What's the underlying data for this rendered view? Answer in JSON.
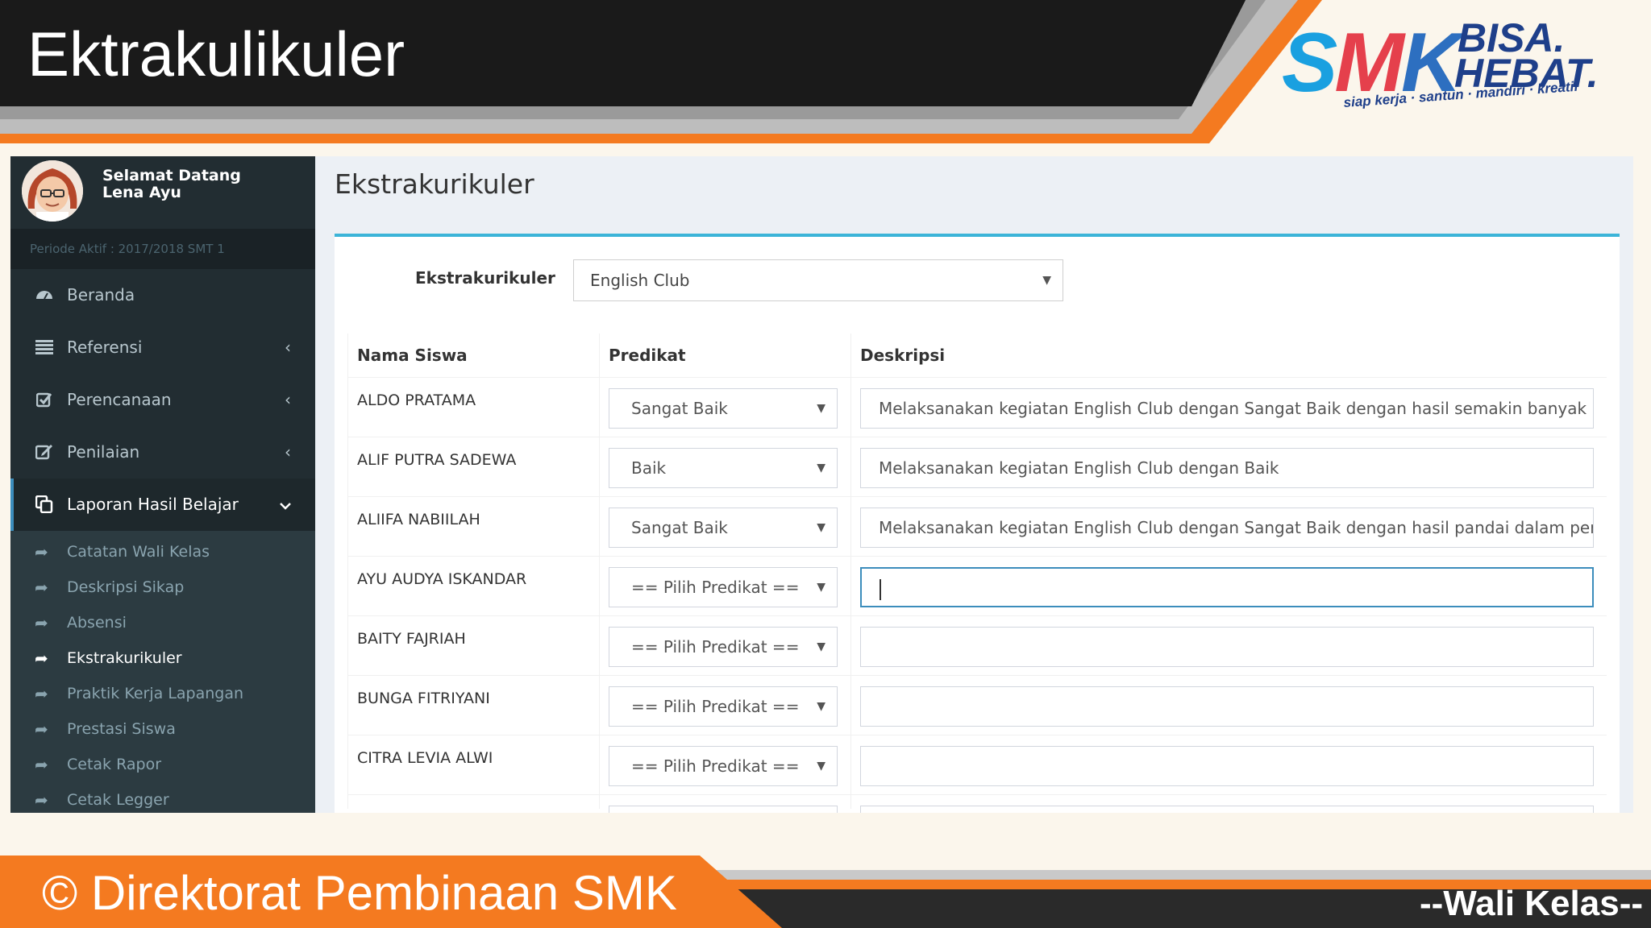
{
  "banner": {
    "title": "Ektrakulikuler",
    "logo": {
      "brand": "SMK",
      "line1": "BISA.",
      "line2": "HEBAT.",
      "tagline": "siap kerja · santun · mandiri · kreatif"
    }
  },
  "sidebar": {
    "welcome_line1": "Selamat Datang",
    "welcome_line2": "Lena Ayu",
    "period": "Periode Aktif : 2017/2018 SMT 1",
    "menu": [
      {
        "label": "Beranda",
        "icon": "dashboard-icon"
      },
      {
        "label": "Referensi",
        "icon": "list-icon"
      },
      {
        "label": "Perencanaan",
        "icon": "checkbox-icon"
      },
      {
        "label": "Penilaian",
        "icon": "edit-icon"
      },
      {
        "label": "Laporan Hasil Belajar",
        "icon": "copy-icon"
      }
    ],
    "submenu": [
      "Catatan Wali Kelas",
      "Deskripsi Sikap",
      "Absensi",
      "Ekstrakurikuler",
      "Praktik Kerja Lapangan",
      "Prestasi Siswa",
      "Cetak Rapor",
      "Cetak Legger"
    ]
  },
  "content": {
    "title": "Ekstrakurikuler",
    "filter_label": "Ekstrakurikuler",
    "filter_value": "English Club",
    "columns": [
      "Nama Siswa",
      "Predikat",
      "Deskripsi"
    ],
    "rows": [
      {
        "name": "ALDO PRATAMA",
        "predikat": "Sangat Baik",
        "deskripsi": "Melaksanakan kegiatan English Club dengan Sangat Baik dengan hasil semakin banyak ko:"
      },
      {
        "name": "ALIF PUTRA SADEWA",
        "predikat": "Baik",
        "deskripsi": "Melaksanakan kegiatan English Club dengan Baik"
      },
      {
        "name": "ALIIFA NABIILAH",
        "predikat": "Sangat Baik",
        "deskripsi": "Melaksanakan kegiatan English Club dengan Sangat Baik dengan hasil pandai dalam perca"
      },
      {
        "name": "AYU AUDYA ISKANDAR",
        "predikat": "== Pilih Predikat ==",
        "deskripsi": ""
      },
      {
        "name": "BAITY FAJRIAH",
        "predikat": "== Pilih Predikat ==",
        "deskripsi": ""
      },
      {
        "name": "BUNGA FITRIYANI",
        "predikat": "== Pilih Predikat ==",
        "deskripsi": ""
      },
      {
        "name": "CITRA LEVIA ALWI",
        "predikat": "== Pilih Predikat ==",
        "deskripsi": ""
      }
    ]
  },
  "footer": {
    "copyright": "© Direktorat Pembinaan SMK",
    "role": "--Wali Kelas--"
  },
  "colors": {
    "sidebar_bg": "#222d32",
    "accent_blue": "#3c8dbc",
    "box_top": "#3cb4d8",
    "banner_dark": "#1a1a1a",
    "banner_orange": "#f47a20"
  }
}
